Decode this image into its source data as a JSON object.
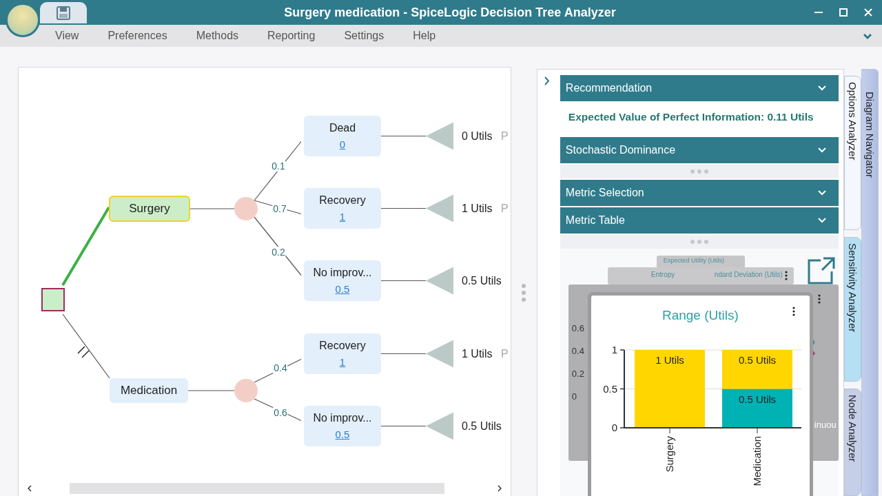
{
  "window": {
    "title": "Surgery medication - SpiceLogic Decision Tree Analyzer"
  },
  "menu": [
    "View",
    "Preferences",
    "Methods",
    "Reporting",
    "Settings",
    "Help"
  ],
  "tree": {
    "options": [
      {
        "label": "Surgery",
        "selected": true,
        "pruned": false,
        "branches": [
          {
            "probability": "0.1",
            "label": "Dead",
            "value": "0",
            "utility": "0 Utils",
            "p_label": "P"
          },
          {
            "probability": "0.7",
            "label": "Recovery",
            "value": "1",
            "utility": "1 Utils",
            "p_label": "P"
          },
          {
            "probability": "0.2",
            "label": "No improv...",
            "value": "0.5",
            "utility": "0.5 Utils"
          }
        ]
      },
      {
        "label": "Medication",
        "selected": false,
        "pruned": true,
        "branches": [
          {
            "probability": "0.4",
            "label": "Recovery",
            "value": "1",
            "utility": "1 Utils",
            "p_label": "P"
          },
          {
            "probability": "0.6",
            "label": "No improv...",
            "value": "0.5",
            "utility": "0.5 Utils"
          }
        ]
      }
    ]
  },
  "panel": {
    "section_groups": [
      {
        "sections": [
          {
            "title": "Recommendation",
            "content": "Expected Value of Perfect Information: 0.11 Utils"
          },
          {
            "title": "Stochastic Dominance"
          }
        ]
      },
      {
        "sections": [
          {
            "title": "Metric Selection"
          },
          {
            "title": "Metric Table"
          }
        ]
      }
    ],
    "back_cards": {
      "top_title": "Expected Utility (Utils)",
      "left_title": "Entropy",
      "right_title": "ndard Deviation (Utils)",
      "ticks": [
        "0.6",
        "0.4",
        "0.2",
        "0"
      ],
      "faded_text": "inuou"
    },
    "front_card": {
      "chart_data": {
        "type": "bar",
        "title": "Range (Utils)",
        "categories": [
          "Surgery",
          "Medication"
        ],
        "stacked": true,
        "ylim": [
          0,
          1
        ],
        "yticks": [
          0,
          0.5,
          1
        ],
        "series": [
          {
            "color": "#00b2b4",
            "values": [
              0,
              0.5
            ]
          },
          {
            "color": "#ffd600",
            "values": [
              1,
              0.5
            ]
          }
        ],
        "value_labels": [
          [
            null,
            "0.5 Utils"
          ],
          [
            "1 Utils",
            "0.5 Utils"
          ]
        ]
      }
    }
  },
  "outer_tabs": [
    {
      "label": "Diagram Navigator"
    }
  ],
  "inner_tabs": [
    {
      "label": "Options Analyzer",
      "selected": true,
      "hovered": false
    },
    {
      "label": "Sensitivity Analyzer",
      "selected": false,
      "hovered": true
    },
    {
      "label": "Node Analyzer",
      "selected": false,
      "hovered": false
    }
  ]
}
